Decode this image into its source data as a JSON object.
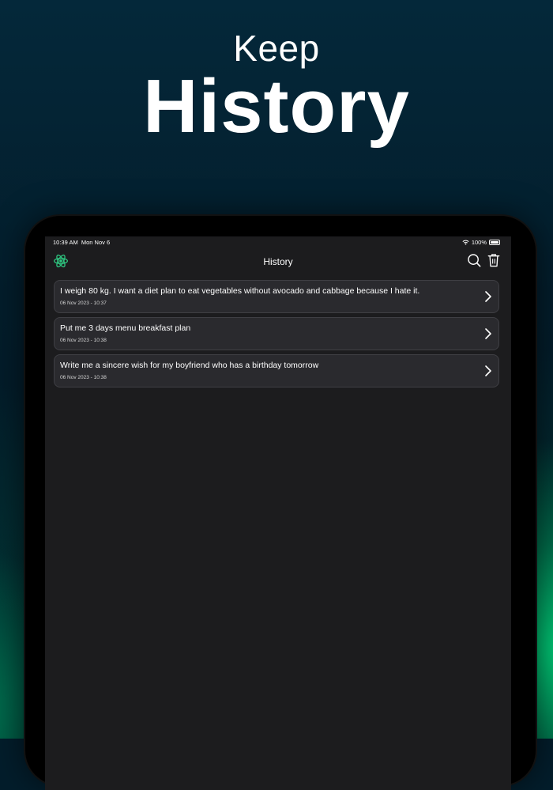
{
  "promo": {
    "line1": "Keep",
    "line2": "History"
  },
  "status_bar": {
    "time": "10:39 AM",
    "date": "Mon Nov 6",
    "battery": "100%"
  },
  "nav": {
    "title": "History"
  },
  "history": [
    {
      "title": "I weigh 80 kg. I want a diet plan to eat vegetables without avocado and cabbage because I hate it.",
      "date": "06 Nov 2023 - 10:37"
    },
    {
      "title": "Put me 3 days menu breakfast plan",
      "date": "06 Nov 2023 - 10:38"
    },
    {
      "title": "Write me a sincere wish for my boyfriend who has a birthday tomorrow",
      "date": "06 Nov 2023 - 10:38"
    }
  ],
  "colors": {
    "accent": "#2ec27e",
    "card_bg": "#2a2a2e",
    "screen_bg": "#1c1c1e",
    "page_bg": "#031d2b"
  }
}
